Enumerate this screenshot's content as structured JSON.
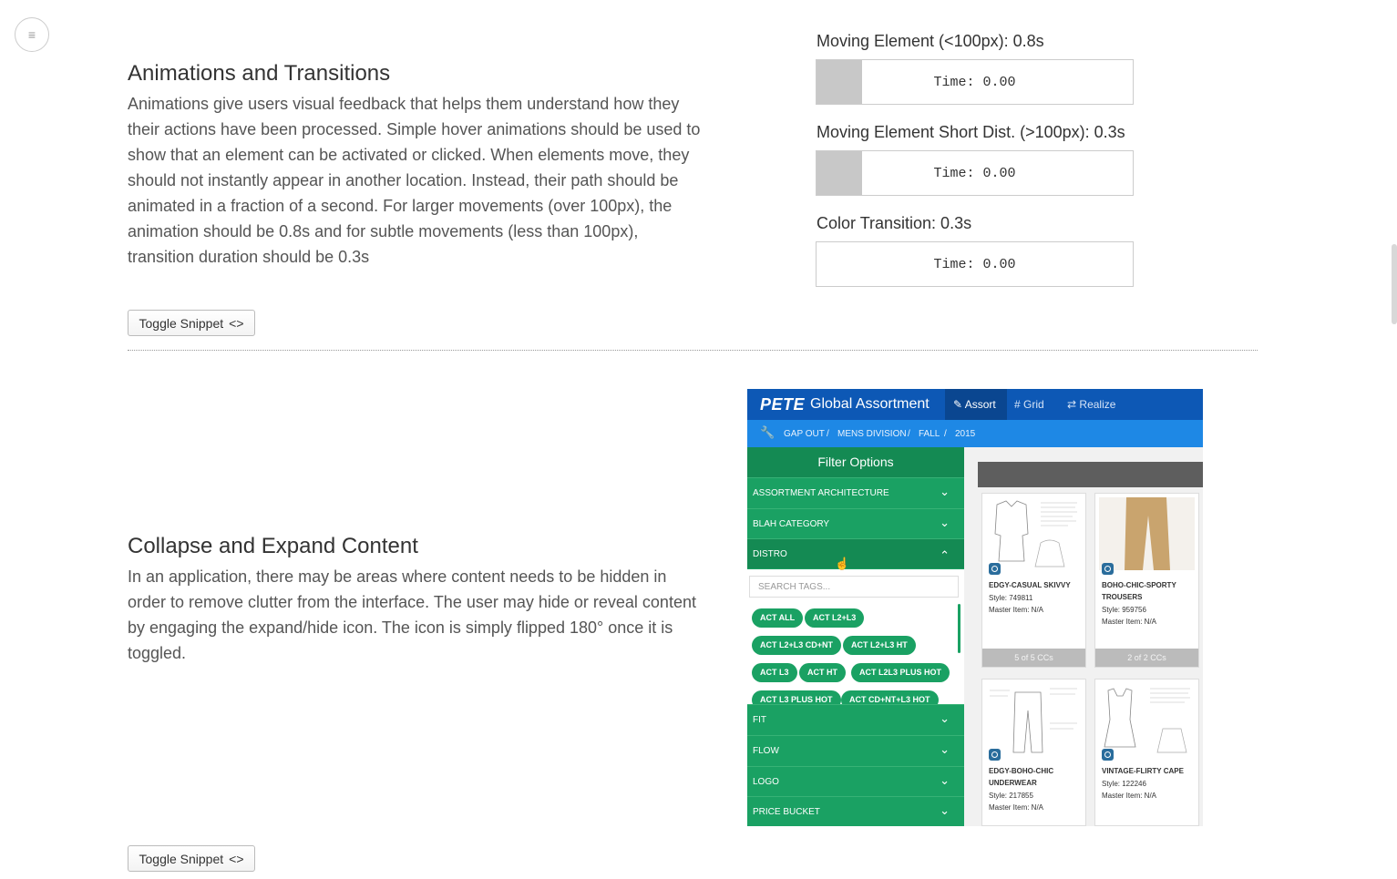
{
  "menu_icon": "≡",
  "section1": {
    "title": "Animations and Transitions",
    "body": "Animations give users visual feedback that helps them understand how they their actions have been processed. Simple hover animations should be used to show that an element can be activated or clicked. When elements move, they should not instantly appear in another location. Instead, their path should be animated in a fraction of a second. For larger movements (over 100px), the animation should be 0.8s and for subtle movements (less than 100px), transition duration should be 0.3s",
    "toggle_label": "Toggle Snippet",
    "toggle_icon": "<>",
    "demos": [
      {
        "label": "Moving Element (<100px): 0.8s",
        "time": "Time: 0.00"
      },
      {
        "label": "Moving Element Short Dist. (>100px): 0.3s",
        "time": "Time: 0.00"
      },
      {
        "label": "Color Transition: 0.3s",
        "time": "Time: 0.00"
      }
    ]
  },
  "section2": {
    "title": "Collapse and Expand Content",
    "body": "In an application, there may be areas where content needs to be hidden in order to remove clutter from the interface. The user may hide or reveal content by engaging the expand/hide icon. The icon is simply flipped 180° once it is toggled.",
    "toggle_label": "Toggle Snippet",
    "toggle_icon": "<>"
  },
  "app": {
    "logo": "PETE",
    "title": "Global Assortment",
    "nav": [
      {
        "icon": "pin-icon",
        "glyph": "📌",
        "label": "Assort",
        "active": true
      },
      {
        "icon": "grid-icon",
        "glyph": "#",
        "label": "Grid",
        "active": false
      },
      {
        "icon": "swap-icon",
        "glyph": "⇄",
        "label": "Realize",
        "active": false
      }
    ],
    "breadcrumb": [
      "GAP OUT",
      "MENS DIVISION",
      "FALL",
      "2015"
    ],
    "breadcrumb_sep": "/",
    "filter_title": "Filter Options",
    "filters": [
      "ASSORTMENT ARCHITECTURE",
      "BLAH CATEGORY",
      "DISTRO",
      "FIT",
      "FLOW",
      "LOGO",
      "PRICE BUCKET"
    ],
    "search_placeholder": "SEARCH TAGS...",
    "tags": [
      "ACT ALL",
      "ACT L2+L3",
      "ACT L2+L3 CD+NT",
      "ACT L2+L3 HT",
      "ACT L3",
      "ACT HT",
      "ACT L2L3 PLUS HOT",
      "ACT L3 PLUS HOT",
      "ACT CD+NT+L3 HOT"
    ],
    "products": [
      {
        "name": "EDGY-CASUAL SKIVVY",
        "style": "Style: 749811",
        "master": "Master Item: N/A",
        "ccs": "5 of 5 CCs"
      },
      {
        "name": "BOHO-CHIC-SPORTY TROUSERS",
        "style": "Style: 959756",
        "master": "Master Item: N/A",
        "ccs": "2 of 2 CCs"
      },
      {
        "name": "EDGY-BOHO-CHIC UNDERWEAR",
        "style": "Style: 217855",
        "master": "Master Item: N/A",
        "ccs": ""
      },
      {
        "name": "VINTAGE-FLIRTY CAPE",
        "style": "Style: 122246",
        "master": "Master Item: N/A",
        "ccs": ""
      }
    ]
  }
}
